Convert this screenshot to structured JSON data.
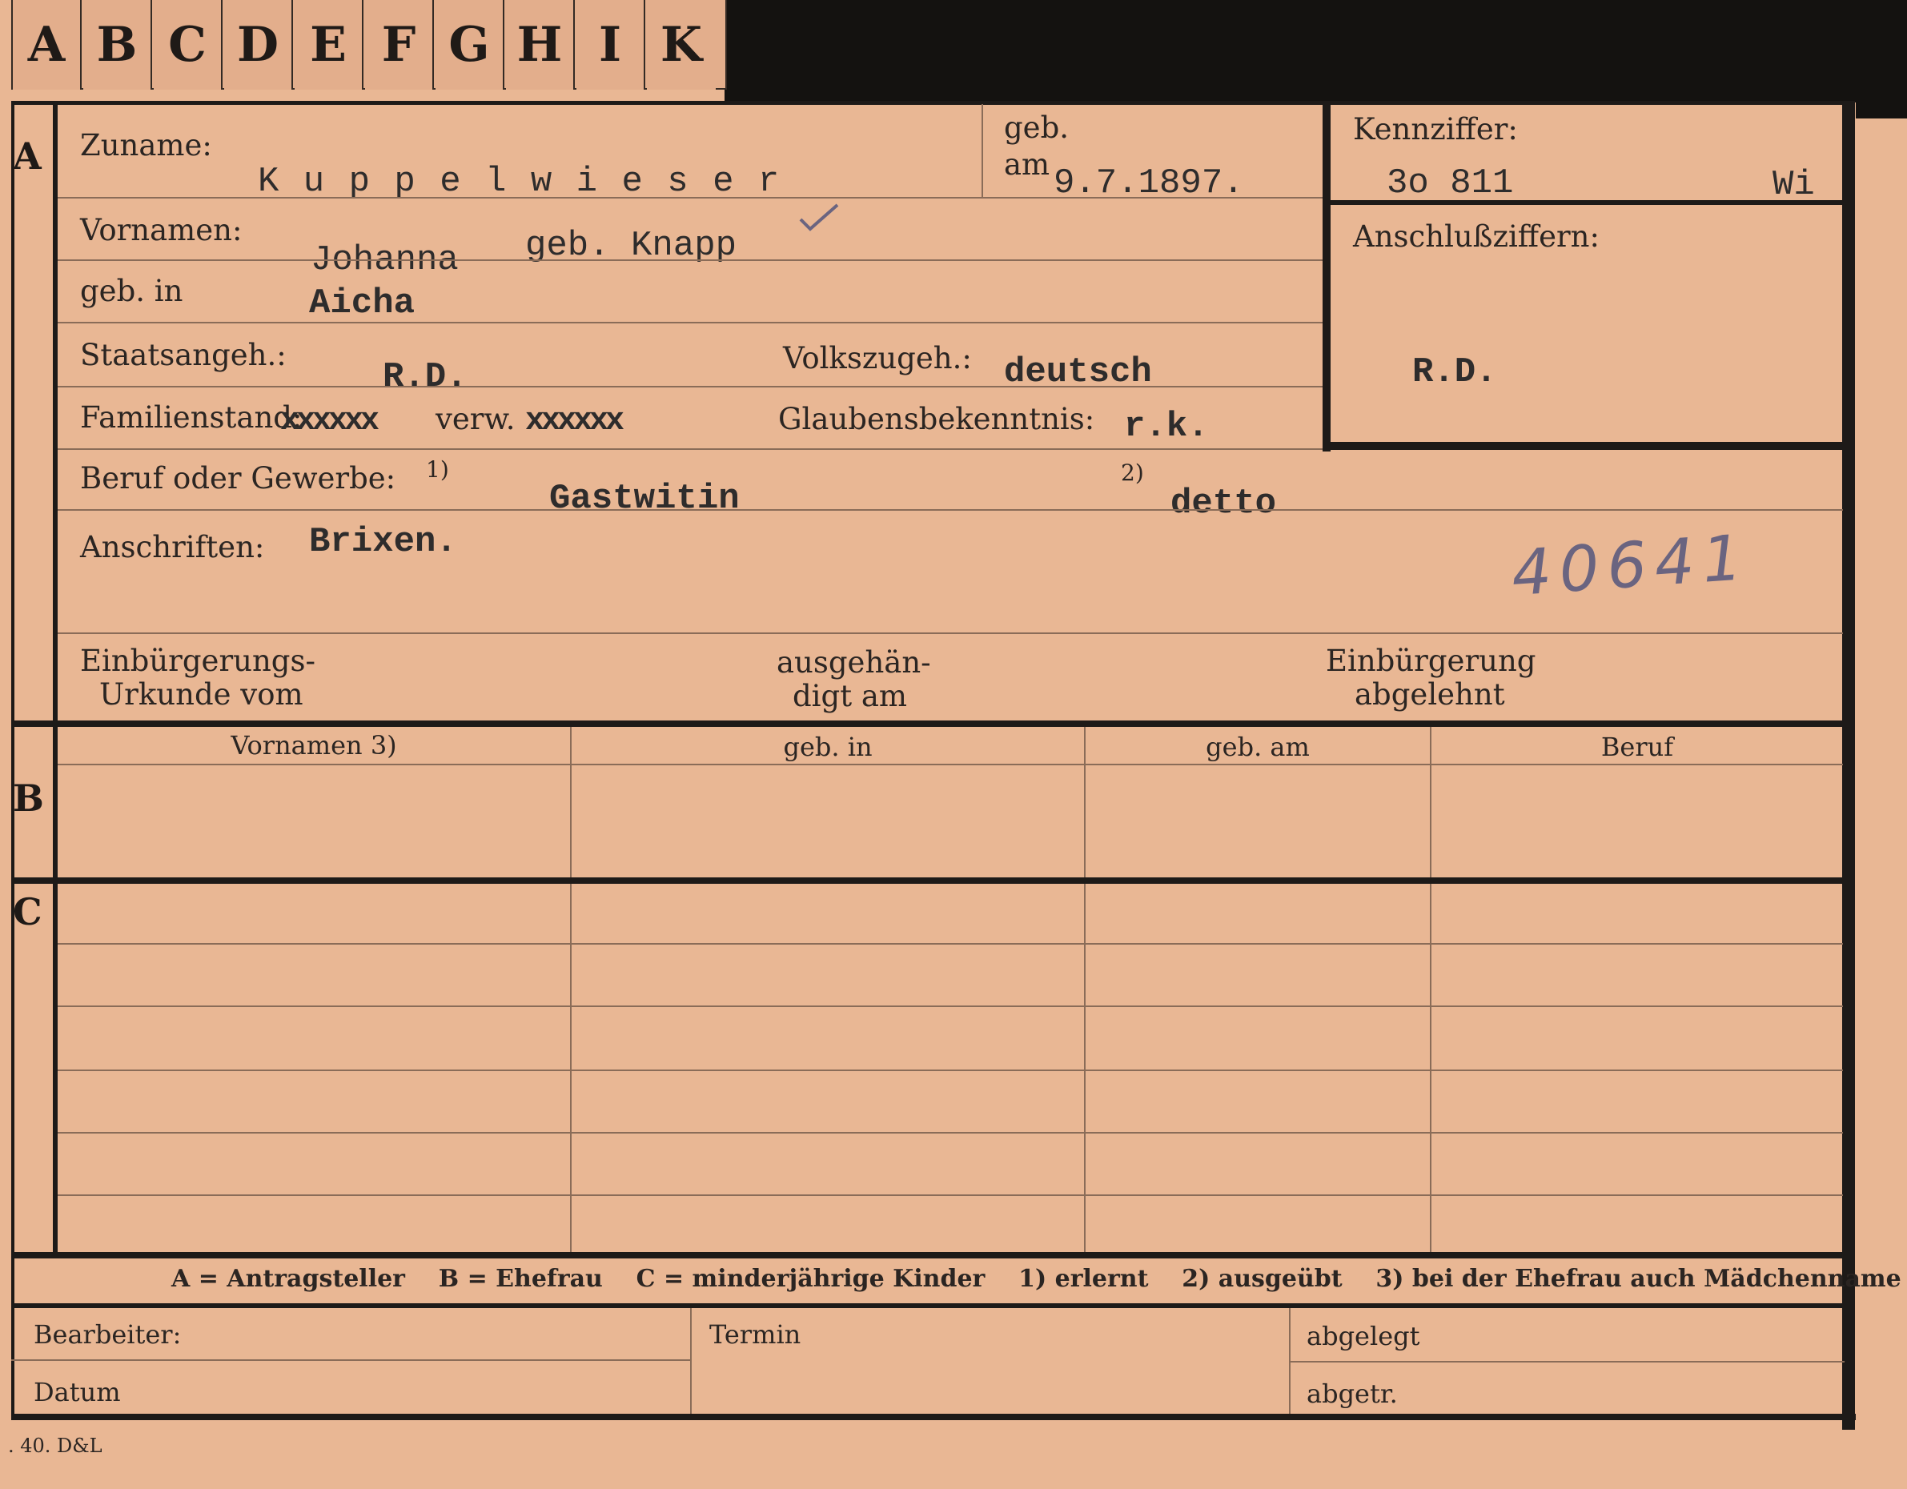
{
  "tabs": [
    "A",
    "B",
    "C",
    "D",
    "E",
    "F",
    "G",
    "H",
    "I",
    "K"
  ],
  "section_a": {
    "marker": "A",
    "zuname_label": "Zuname:",
    "zuname_value": "K u p p e l w i e s e r",
    "geb_label": "geb.",
    "am_label": "am",
    "geb_am_value": "9.7.1897.",
    "vornamen_label": "Vornamen:",
    "vornamen_value": "Johanna",
    "vornamen_extra": "geb. Knapp",
    "geb_in_label": "geb. in",
    "geb_in_value": "Aicha",
    "staatsangeh_label": "Staatsangeh.:",
    "staatsangeh_value": "R.D.",
    "volkszugeh_label": "Volkszugeh.:",
    "volkszugeh_value": "deutsch",
    "familienstand_label": "Familienstand:",
    "familienstand_strike1": "xxxxxx",
    "familienstand_verw": "verw.",
    "familienstand_strike2": "xxxxxx",
    "glaubens_label": "Glaubensbekenntnis:",
    "glaubens_value": "r.k.",
    "beruf_label": "Beruf oder Gewerbe:",
    "beruf_note1": "1)",
    "beruf_value1": "Gastwitin",
    "beruf_note2": "2)",
    "beruf_value2": "detto",
    "anschriften_label": "Anschriften:",
    "anschriften_value": "Brixen.",
    "handwritten_number": "40641",
    "einb_urkunde_label_1": "Einbürgerungs-",
    "einb_urkunde_label_2": "Urkunde vom",
    "ausgehaendigt_label_1": "ausgehän-",
    "ausgehaendigt_label_2": "digt am",
    "einb_abgelehnt_label_1": "Einbürgerung",
    "einb_abgelehnt_label_2": "abgelehnt"
  },
  "kennziffer": {
    "label": "Kennziffer:",
    "value": "3o 811",
    "suffix": "Wi",
    "anschluss_label": "Anschlußziffern:",
    "anschluss_value": "R.D."
  },
  "section_b": {
    "marker": "B",
    "headers": [
      "Vornamen 3)",
      "geb. in",
      "geb. am",
      "Beruf"
    ]
  },
  "section_c": {
    "marker": "C"
  },
  "legend": "A = Antragsteller    B = Ehefrau    C = minderjährige Kinder    1) erlernt    2) ausgeübt    3) bei der Ehefrau auch Mädchenname",
  "footer": {
    "bearbeiter_label": "Bearbeiter:",
    "datum_label": "Datum",
    "termin_label": "Termin",
    "abgelegt_label": "abgelegt",
    "abgetr_label": "abgetr."
  },
  "print_mark": ". 40. D&L"
}
